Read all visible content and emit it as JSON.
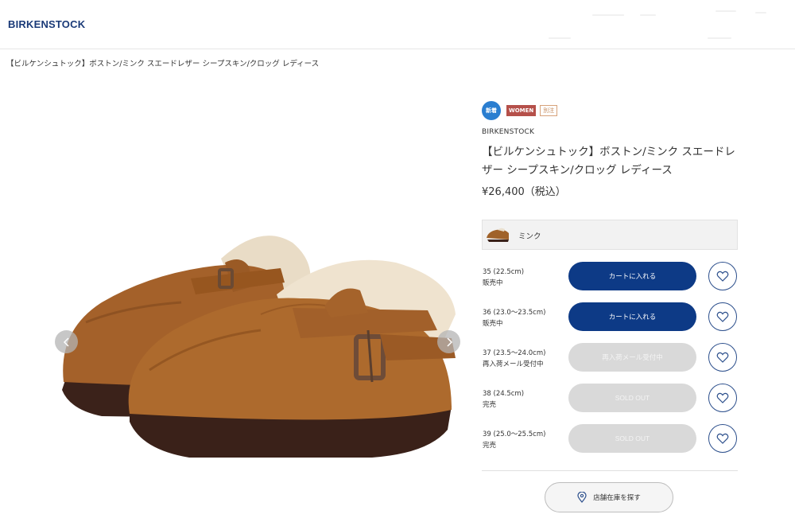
{
  "header": {
    "logo": "BIRKENSTOCK"
  },
  "breadcrumb": "【ビルケンシュトック】ボストン/ミンク スエードレザー シープスキン/クロッグ レディース",
  "product": {
    "badges": {
      "new": "新着",
      "women": "WOMEN",
      "limited": "別注"
    },
    "brand": "BIRKENSTOCK",
    "title": "【ビルケンシュトック】ボストン/ミンク スエードレザー シープスキン/クロッグ レディース",
    "price": "¥26,400（税込）",
    "color": {
      "name": "ミンク",
      "swatch": "#a0622a"
    },
    "sizes": [
      {
        "size": "35 (22.5cm)",
        "status": "販売中",
        "button": "カートに入れる",
        "available": true
      },
      {
        "size": "36 (23.0〜23.5cm)",
        "status": "販売中",
        "button": "カートに入れる",
        "available": true
      },
      {
        "size": "37 (23.5〜24.0cm)",
        "status": "再入荷メール受付中",
        "button": "再入荷メール受付中",
        "available": false
      },
      {
        "size": "38 (24.5cm)",
        "status": "完売",
        "button": "SOLD OUT",
        "available": false
      },
      {
        "size": "39 (25.0〜25.5cm)",
        "status": "完売",
        "button": "SOLD OUT",
        "available": false
      }
    ],
    "store_button": "店舗在庫を探す"
  },
  "colors": {
    "brand_navy": "#0d3a86",
    "badge_blue": "#2a7ed0",
    "badge_red": "#b5504a",
    "disabled": "#d9d9d9"
  },
  "icons": {
    "prev": "chevron-left-icon",
    "next": "chevron-right-icon",
    "favorite": "heart-icon",
    "store": "location-pin-icon"
  }
}
